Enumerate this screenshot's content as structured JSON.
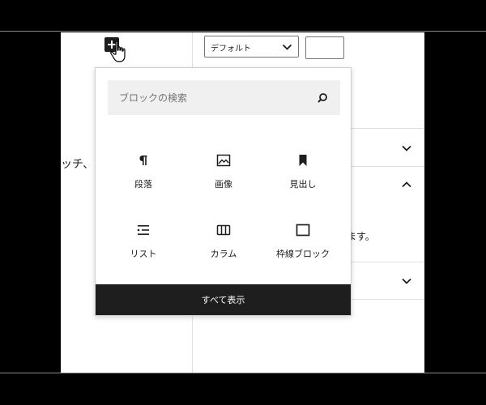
{
  "editor": {
    "paragraph_snippet": "ッチ、"
  },
  "sidebar": {
    "style_select": {
      "value": "デフォルト",
      "icon": "chevron-down-icon"
    },
    "size_input": {
      "value": ""
    },
    "panels": [
      {
        "state": "collapsed",
        "icon": "chevron-down-icon"
      },
      {
        "state": "expanded",
        "icon": "chevron-up-icon",
        "text": "ます。"
      },
      {
        "state": "collapsed",
        "icon": "chevron-down-icon"
      }
    ]
  },
  "inserter": {
    "search": {
      "placeholder": "ブロックの検索",
      "value": "",
      "icon": "search-icon"
    },
    "blocks": [
      {
        "label": "段落",
        "icon": "paragraph-icon"
      },
      {
        "label": "画像",
        "icon": "image-icon"
      },
      {
        "label": "見出し",
        "icon": "heading-bookmark-icon"
      },
      {
        "label": "リスト",
        "icon": "list-icon"
      },
      {
        "label": "カラム",
        "icon": "columns-icon"
      },
      {
        "label": "枠線ブロック",
        "icon": "bordered-box-icon"
      }
    ],
    "browse_all_label": "すべて表示"
  },
  "colors": {
    "frame": "#000000",
    "accent": "#1e1e1e",
    "search_bg": "#f0f0f0"
  }
}
